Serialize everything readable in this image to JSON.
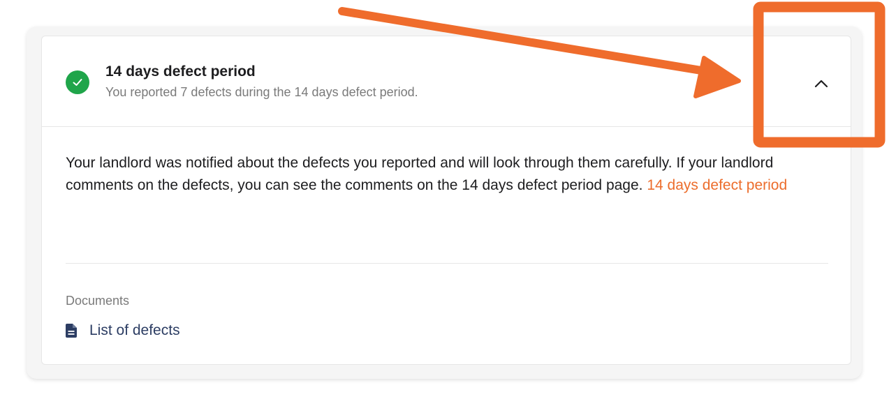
{
  "header": {
    "title": "14 days defect period",
    "subtitle": "You reported 7 defects during the 14 days defect period.",
    "status_icon": "check-circle-icon",
    "toggle_icon": "chevron-up-icon"
  },
  "body": {
    "message": "Your landlord was notified about the defects you reported and will look through them carefully. If your landlord comments on the defects, you can see the comments on the 14 days defect period page. ",
    "link_label": "14 days defect period"
  },
  "documents": {
    "label": "Documents",
    "items": [
      {
        "label": "List of defects",
        "icon": "file-text-icon"
      }
    ]
  },
  "colors": {
    "success": "#1fa54a",
    "link": "#ec6d2c",
    "annotation": "#ef6c2c",
    "document_link": "#2c3d63"
  }
}
